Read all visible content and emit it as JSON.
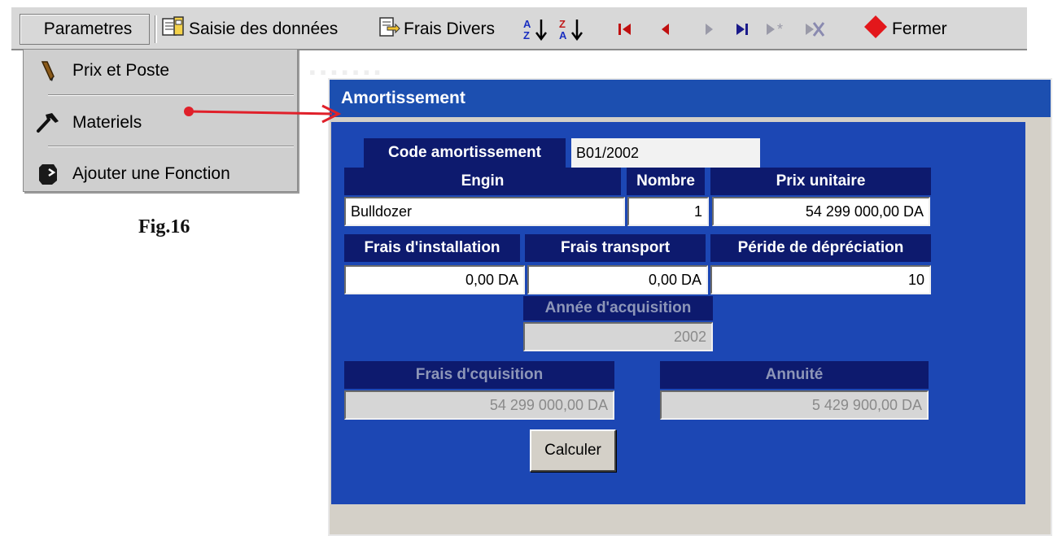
{
  "toolbar": {
    "parametres": "Parametres",
    "saisie": "Saisie des données",
    "frais_divers": "Frais Divers",
    "fermer": "Fermer"
  },
  "menu": {
    "items": [
      {
        "label": "Prix et Poste",
        "icon": "pencil-icon"
      },
      {
        "label": "Materiels",
        "icon": "hammer-icon"
      },
      {
        "label": "Ajouter une Fonction",
        "icon": "function-icon"
      }
    ]
  },
  "figure_label": "Fig.16",
  "window": {
    "title": "Amortissement",
    "code_label": "Code amortissement",
    "code_value": "B01/2002",
    "engin_label": "Engin",
    "nombre_label": "Nombre",
    "prix_label": "Prix unitaire",
    "engin_value": "Bulldozer",
    "nombre_value": "1",
    "prix_value": "54 299 000,00 DA",
    "install_label": "Frais d'installation",
    "transport_label": "Frais transport",
    "periode_label": "Péride de dépréciation",
    "install_value": "0,00 DA",
    "transport_value": "0,00 DA",
    "periode_value": "10",
    "annee_label": "Année d'acquisition",
    "annee_value": "2002",
    "acq_label": "Frais d'cquisition",
    "acq_value": "54 299 000,00 DA",
    "annuite_label": "Annuité",
    "annuite_value": "5 429 900,00 DA",
    "calc_button": "Calculer"
  },
  "colors": {
    "title_bar": "#1c4fb0",
    "client_bg": "#1c47b4",
    "label_bg": "#0d1a6e",
    "arrow": "#e0202a"
  }
}
